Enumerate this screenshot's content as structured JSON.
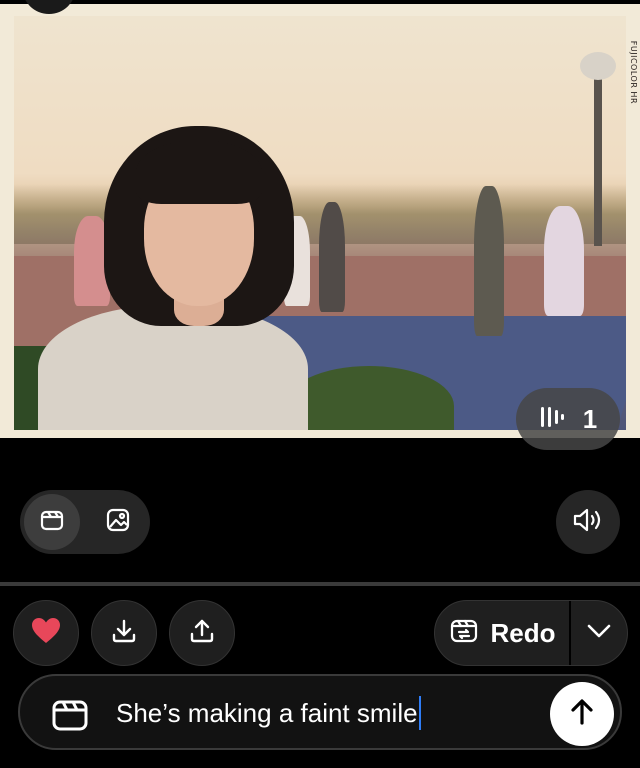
{
  "photo": {
    "film_label": "FUJICOLOR HR"
  },
  "counter": {
    "count": "1",
    "icon": "voice-bars-icon"
  },
  "mode_toggle": {
    "selected": "video",
    "options": [
      "video",
      "image"
    ]
  },
  "actions": {
    "like_icon": "heart-icon",
    "like_color": "#e8475a",
    "download_icon": "download-icon",
    "share_icon": "share-icon"
  },
  "redo": {
    "label": "Redo"
  },
  "prompt": {
    "value": "She’s making a faint smile"
  },
  "colors": {
    "background": "#000000",
    "accent_caret": "#2f7df6"
  }
}
